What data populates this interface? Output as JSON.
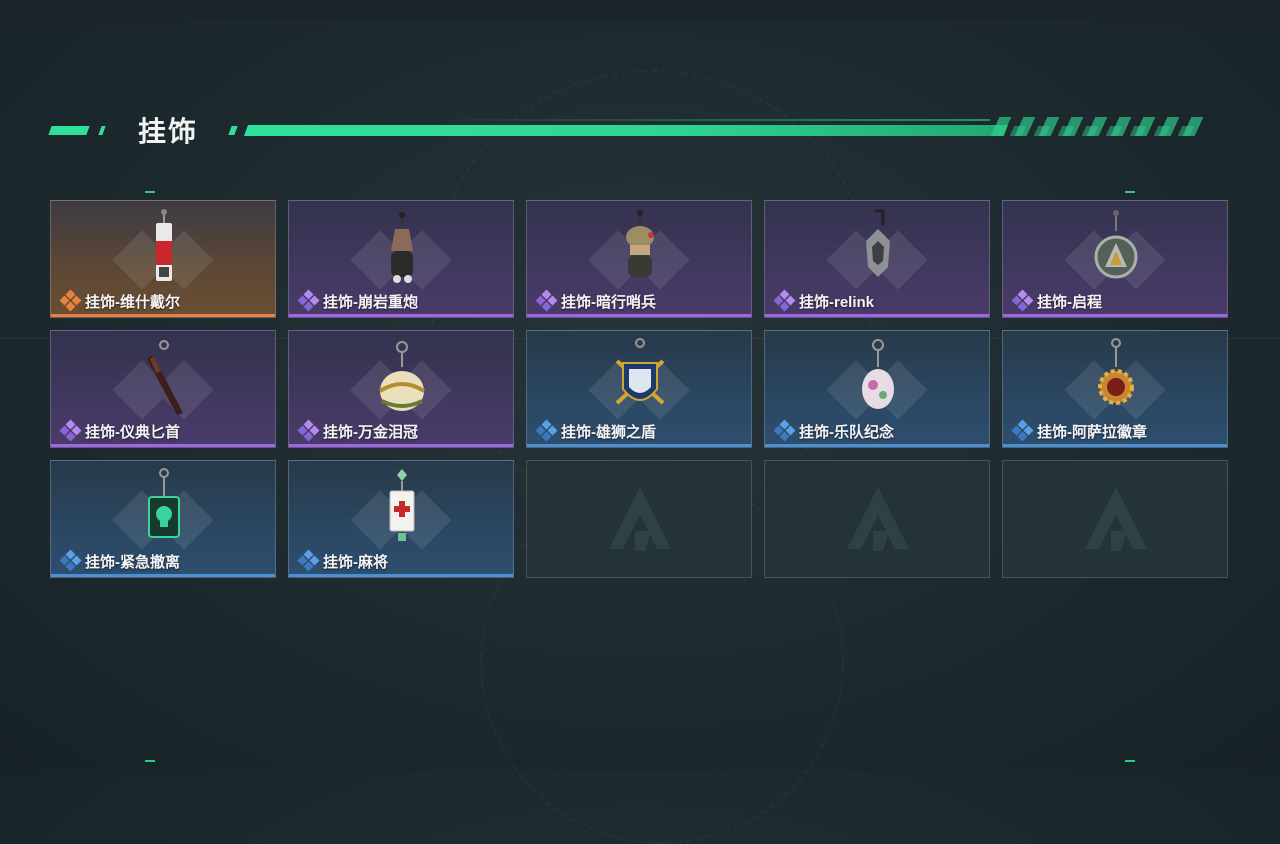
{
  "section": {
    "title": "挂饰"
  },
  "colors": {
    "accent": "#2fe09a",
    "rarity_orange": "#e8813b",
    "rarity_purple": "#a166e6",
    "rarity_blue": "#4a90d6"
  },
  "items": [
    {
      "name": "挂饰-维什戴尔",
      "rarity": "orange",
      "icon": "red-battery-charm-icon"
    },
    {
      "name": "挂饰-崩岩重炮",
      "rarity": "purple",
      "icon": "hooded-figure-charm-icon"
    },
    {
      "name": "挂饰-暗行哨兵",
      "rarity": "purple",
      "icon": "soldier-figure-charm-icon"
    },
    {
      "name": "挂饰-relink",
      "rarity": "purple",
      "icon": "turtle-shell-charm-icon"
    },
    {
      "name": "挂饰-启程",
      "rarity": "purple",
      "icon": "round-medallion-charm-icon"
    },
    {
      "name": "挂饰-仪典匕首",
      "rarity": "purple",
      "icon": "dagger-charm-icon"
    },
    {
      "name": "挂饰-万金泪冠",
      "rarity": "purple",
      "icon": "golden-orb-charm-icon"
    },
    {
      "name": "挂饰-雄狮之盾",
      "rarity": "blue",
      "icon": "lion-shield-charm-icon"
    },
    {
      "name": "挂饰-乐队纪念",
      "rarity": "blue",
      "icon": "band-badge-charm-icon"
    },
    {
      "name": "挂饰-阿萨拉徽章",
      "rarity": "blue",
      "icon": "sun-badge-charm-icon"
    },
    {
      "name": "挂饰-紧急撤离",
      "rarity": "blue",
      "icon": "skull-tag-charm-icon"
    },
    {
      "name": "挂饰-麻将",
      "rarity": "blue",
      "icon": "mahjong-tile-charm-icon"
    },
    {
      "name": "",
      "rarity": "empty",
      "icon": "empty-slot-logo-icon"
    },
    {
      "name": "",
      "rarity": "empty",
      "icon": "empty-slot-logo-icon"
    },
    {
      "name": "",
      "rarity": "empty",
      "icon": "empty-slot-logo-icon"
    }
  ]
}
